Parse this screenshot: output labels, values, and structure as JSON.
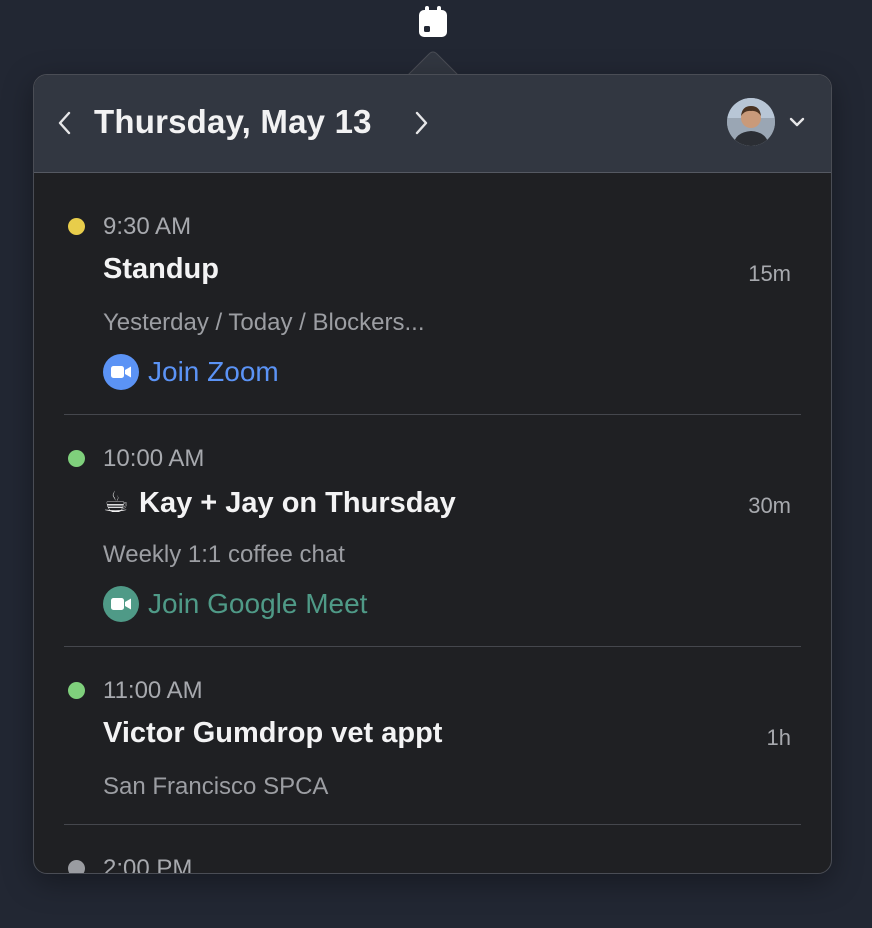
{
  "header": {
    "date": "Thursday, May 13"
  },
  "events": [
    {
      "time": "9:30 AM",
      "title": "Standup",
      "duration": "15m",
      "description": "Yesterday / Today / Blockers...",
      "join_label": "Join Zoom",
      "dot_color": "#e8cd4b",
      "join_color": "#5b93f5"
    },
    {
      "time": "10:00 AM",
      "title_emoji": "☕",
      "title": "Kay + Jay on Thursday",
      "duration": "30m",
      "description": "Weekly 1:1 coffee chat",
      "join_label": "Join Google Meet",
      "dot_color": "#7fd07c",
      "join_color": "#4f9a87"
    },
    {
      "time": "11:00 AM",
      "title": "Victor Gumdrop vet appt",
      "duration": "1h",
      "description": "San Francisco SPCA",
      "dot_color": "#7fd07c"
    },
    {
      "time": "2:00 PM",
      "dot_color": "#9a9ca1"
    }
  ],
  "icons": {
    "menubar": "calendar-icon",
    "prev": "chevron-left-icon",
    "next": "chevron-right-icon",
    "account": "chevron-down-icon",
    "zoom": "video-camera-icon",
    "meet": "video-camera-icon"
  }
}
